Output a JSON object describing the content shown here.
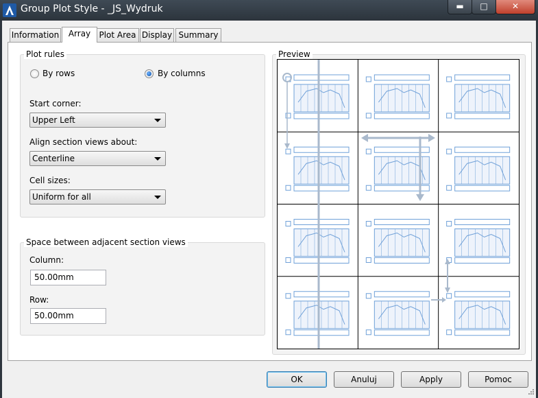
{
  "window": {
    "title": "Group Plot Style - _JS_Wydruk",
    "minimize_glyph": "▬",
    "maximize_glyph": "□",
    "close_glyph": "✕",
    "app_icon": "autocad-a-icon"
  },
  "tabs": [
    {
      "label": "Information"
    },
    {
      "label": "Array"
    },
    {
      "label": "Plot Area"
    },
    {
      "label": "Display"
    },
    {
      "label": "Summary"
    }
  ],
  "active_tab": "Array",
  "plot_rules": {
    "title": "Plot rules",
    "by_rows_label": "By rows",
    "by_columns_label": "By columns",
    "selected": "By columns",
    "start_corner_label": "Start corner:",
    "start_corner_value": "Upper Left",
    "align_label": "Align section views about:",
    "align_value": "Centerline",
    "cell_sizes_label": "Cell sizes:",
    "cell_sizes_value": "Uniform for all"
  },
  "spacing": {
    "title": "Space between adjacent section views",
    "column_label": "Column:",
    "column_value": "50.00mm",
    "row_label": "Row:",
    "row_value": "50.00mm"
  },
  "preview": {
    "title": "Preview",
    "rows": 4,
    "columns": 3,
    "preview_color": "#6fa0d8",
    "arrow_color": "#a9b9cc"
  },
  "buttons": {
    "ok": "OK",
    "cancel": "Anuluj",
    "apply": "Apply",
    "help": "Pomoc"
  }
}
